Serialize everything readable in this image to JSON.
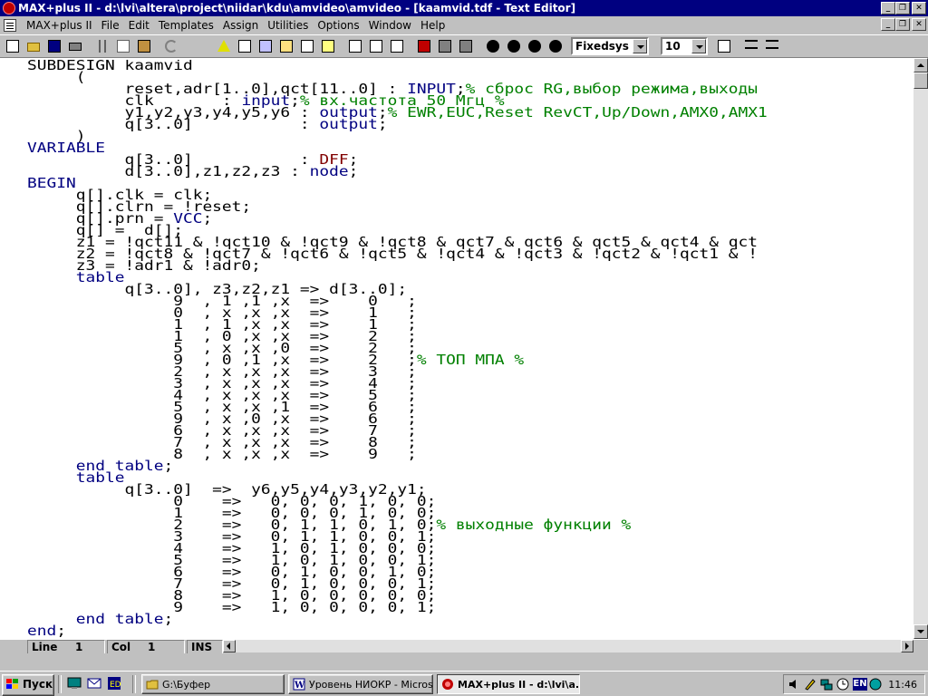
{
  "window": {
    "title": "MAX+plus II - d:\\lvi\\altera\\project\\niidar\\kdu\\amvideo\\amvideo - [kaamvid.tdf - Text Editor]",
    "controls": [
      "_",
      "❐",
      "✕"
    ]
  },
  "menu": {
    "items": [
      "MAX+plus II",
      "File",
      "Edit",
      "Templates",
      "Assign",
      "Utilities",
      "Options",
      "Window",
      "Help"
    ]
  },
  "toolbar": {
    "font_name": "Fixedsys",
    "font_size": "10",
    "icons": [
      "new-icon",
      "open-icon",
      "save-icon",
      "print-icon",
      "cut-icon",
      "copy-icon",
      "paste-icon",
      "undo-icon",
      "warning-icon",
      "hierarchy-up-icon",
      "floorplan-icon",
      "compile-icon",
      "simulate-icon",
      "timing-icon",
      "programmer-icon",
      "save-check-icon",
      "save-compile-icon",
      "save-simulate-icon",
      "find-icon",
      "find-next-icon",
      "replace-icon",
      "goto-icon",
      "print-setup-icon",
      "indent-icon",
      "outdent-icon"
    ]
  },
  "editor": {
    "lines": [
      [
        [
          "",
          "SUBDESIGN kaamvid"
        ]
      ],
      [
        [
          "",
          "     ("
        ]
      ],
      [
        [
          "",
          "          reset,adr[1..0],qct[11..0] : "
        ],
        [
          "kw",
          "INPUT"
        ],
        [
          "",
          ";"
        ],
        [
          "cm",
          "% сброс RG,выбор режима,выходы"
        ]
      ],
      [
        [
          "",
          "          clk       : "
        ],
        [
          "kw",
          "input"
        ],
        [
          "",
          ";"
        ],
        [
          "cm",
          "% вх.частота 50 Мгц %"
        ]
      ],
      [
        [
          "",
          "          y1,y2,y3,y4,y5,y6 : "
        ],
        [
          "kw",
          "output"
        ],
        [
          "",
          ";"
        ],
        [
          "cm",
          "% EWR,EUC,Reset RevCT,Up/Down,AMX0,AMX1"
        ]
      ],
      [
        [
          "",
          "          q[3..0]           : "
        ],
        [
          "kw",
          "output"
        ],
        [
          "",
          ";"
        ]
      ],
      [
        [
          "",
          "     )"
        ]
      ],
      [
        [
          "kw",
          "VARIABLE"
        ]
      ],
      [
        [
          "",
          "          q[3..0]           : "
        ],
        [
          "pp",
          "DFF"
        ],
        [
          "",
          ";"
        ]
      ],
      [
        [
          "",
          "          d[3..0],z1,z2,z3 : "
        ],
        [
          "kw",
          "node"
        ],
        [
          "",
          ";"
        ]
      ],
      [
        [
          "kw",
          "BEGIN"
        ]
      ],
      [
        [
          "",
          "     q[].clk = clk;"
        ]
      ],
      [
        [
          "",
          "     q[].clrn = !reset;"
        ]
      ],
      [
        [
          "",
          "     q[].prn = "
        ],
        [
          "kw",
          "VCC"
        ],
        [
          "",
          ";"
        ]
      ],
      [
        [
          "",
          "     q[] =  d[];"
        ]
      ],
      [
        [
          "",
          "     z1 = !qct11 & !qct10 & !qct9 & !qct8 & qct7 & qct6 & qct5 & qct4 & qct"
        ]
      ],
      [
        [
          "",
          "     z2 = !qct8 & !qct7 & !qct6 & !qct5 & !qct4 & !qct3 & !qct2 & !qct1 & !"
        ]
      ],
      [
        [
          "",
          "     z3 = !adr1 & !adr0;"
        ]
      ],
      [
        [
          "kw",
          "     table"
        ]
      ],
      [
        [
          "",
          "          q[3..0], z3,z2,z1 => d[3..0];"
        ]
      ],
      [
        [
          "",
          "               9  , 1 ,1 ,x  =>    0   ;"
        ]
      ],
      [
        [
          "",
          "               0  , x ,x ,x  =>    1   ;"
        ]
      ],
      [
        [
          "",
          "               1  , 1 ,x ,x  =>    1   ;"
        ]
      ],
      [
        [
          "",
          "               1  , 0 ,x ,x  =>    2   ;"
        ]
      ],
      [
        [
          "",
          "               5  , x ,x ,0  =>    2   ;"
        ]
      ],
      [
        [
          "",
          "               9  , 0 ,1 ,x  =>    2   ;"
        ],
        [
          "cm",
          "% ТОП МПА %"
        ]
      ],
      [
        [
          "",
          "               2  , x ,x ,x  =>    3   ;"
        ]
      ],
      [
        [
          "",
          "               3  , x ,x ,x  =>    4   ;"
        ]
      ],
      [
        [
          "",
          "               4  , x ,x ,x  =>    5   ;"
        ]
      ],
      [
        [
          "",
          "               5  , x ,x ,1  =>    6   ;"
        ]
      ],
      [
        [
          "",
          "               9  , x ,0 ,x  =>    6   ;"
        ]
      ],
      [
        [
          "",
          "               6  , x ,x ,x  =>    7   ;"
        ]
      ],
      [
        [
          "",
          "               7  , x ,x ,x  =>    8   ;"
        ]
      ],
      [
        [
          "",
          "               8  , x ,x ,x  =>    9   ;"
        ]
      ],
      [
        [
          "kw",
          "     end table"
        ],
        [
          "",
          ";"
        ]
      ],
      [
        [
          "kw",
          "     table"
        ]
      ],
      [
        [
          "",
          "          q[3..0]  =>  y6,y5,y4,y3,y2,y1;"
        ]
      ],
      [
        [
          "",
          "               0    =>   0, 0, 0, 1, 0, 0;"
        ]
      ],
      [
        [
          "",
          "               1    =>   0, 0, 0, 1, 0, 0;"
        ]
      ],
      [
        [
          "",
          "               2    =>   0, 1, 1, 0, 1, 0;"
        ],
        [
          "cm",
          "% выходные функции %"
        ]
      ],
      [
        [
          "",
          "               3    =>   0, 1, 1, 0, 0, 1;"
        ]
      ],
      [
        [
          "",
          "               4    =>   1, 0, 1, 0, 0, 0;"
        ]
      ],
      [
        [
          "",
          "               5    =>   1, 0, 1, 0, 0, 1;"
        ]
      ],
      [
        [
          "",
          "               6    =>   0, 1, 0, 0, 1, 0;"
        ]
      ],
      [
        [
          "",
          "               7    =>   0, 1, 0, 0, 0, 1;"
        ]
      ],
      [
        [
          "",
          "               8    =>   1, 0, 0, 0, 0, 0;"
        ]
      ],
      [
        [
          "",
          "               9    =>   1, 0, 0, 0, 0, 1;"
        ]
      ],
      [
        [
          "kw",
          "     end table"
        ],
        [
          "",
          ";"
        ]
      ],
      [
        [
          "kw",
          "end"
        ],
        [
          "",
          ";"
        ]
      ]
    ]
  },
  "status": {
    "line_label": "Line",
    "line_value": "1",
    "col_label": "Col",
    "col_value": "1",
    "mode": "INS"
  },
  "taskbar": {
    "start_label": "Пуск",
    "quick_launch": [
      "desktop-icon",
      "outlook-icon",
      "media-icon"
    ],
    "tasks": [
      {
        "label": "G:\\Буфер",
        "icon": "folder-icon",
        "active": false
      },
      {
        "label": "Уровень НИОКР - Micros...",
        "icon": "word-icon",
        "active": false
      },
      {
        "label": "MAX+plus II - d:\\lvi\\a...",
        "icon": "maxplus-icon",
        "active": true
      }
    ],
    "tray_icons": [
      "volume-icon",
      "pen-icon",
      "network-icon",
      "clock-app-icon",
      "language-icon"
    ],
    "language": "EN",
    "clock": "11:46"
  }
}
